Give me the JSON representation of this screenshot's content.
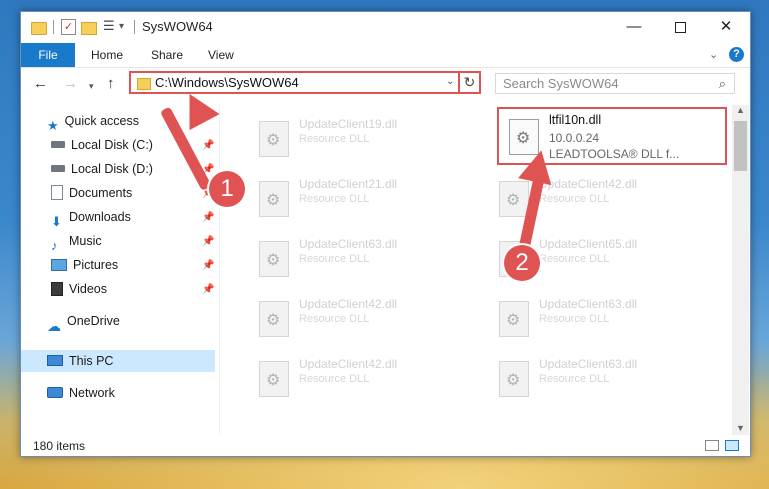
{
  "window": {
    "title": "SysWOW64",
    "controls": {
      "minimize": "—",
      "maximize": "",
      "close": "✕"
    }
  },
  "ribbon": {
    "tabs": [
      "File",
      "Home",
      "Share",
      "View"
    ],
    "help": "?",
    "expand": "⌄"
  },
  "navigation": {
    "back": "←",
    "forward": "→",
    "recent": "▾",
    "up": "↑",
    "address": "C:\\Windows\\SysWOW64",
    "address_dropdown": "⌄",
    "refresh": "↻",
    "search_placeholder": "Search SysWOW64",
    "search_icon": "⌕"
  },
  "sidebar": {
    "items": [
      {
        "label": "Quick access",
        "icon": "star-icon",
        "pinned": false
      },
      {
        "label": "Local Disk (C:)",
        "icon": "drive-icon",
        "pinned": true
      },
      {
        "label": "Local Disk (D:)",
        "icon": "drive-icon",
        "pinned": true
      },
      {
        "label": "Documents",
        "icon": "documents-icon",
        "pinned": true
      },
      {
        "label": "Downloads",
        "icon": "download-icon",
        "pinned": true
      },
      {
        "label": "Music",
        "icon": "music-icon",
        "pinned": true
      },
      {
        "label": "Pictures",
        "icon": "pictures-icon",
        "pinned": true
      },
      {
        "label": "Videos",
        "icon": "videos-icon",
        "pinned": true
      },
      {
        "label": "OneDrive",
        "icon": "cloud-icon",
        "pinned": false
      },
      {
        "label": "This PC",
        "icon": "computer-icon",
        "pinned": false,
        "selected": true
      },
      {
        "label": "Network",
        "icon": "network-icon",
        "pinned": false
      }
    ]
  },
  "files": {
    "highlighted": {
      "name": "ltfil10n.dll",
      "version": "10.0.0.24",
      "company": "LEADTOOLSA® DLL f..."
    },
    "tiles": [
      {
        "name": "UpdateClient19.dll",
        "type": "Resource DLL"
      },
      {
        "name": "UpdateClient21.dll",
        "type": "Resource DLL"
      },
      {
        "name": "UpdateClient42.dll",
        "type": "Resource DLL"
      },
      {
        "name": "UpdateClient63.dll",
        "type": "Resource DLL"
      },
      {
        "name": "UpdateClient65.dll",
        "type": "Resource DLL"
      },
      {
        "name": "UpdateClient42.dll",
        "type": "Resource DLL"
      },
      {
        "name": "UpdateClient63.dll",
        "type": "Resource DLL"
      },
      {
        "name": "UpdateClient42.dll",
        "type": "Resource DLL"
      },
      {
        "name": "UpdateClient63.dll",
        "type": "Resource DLL"
      }
    ]
  },
  "status": {
    "item_count": "180 items"
  },
  "annotations": {
    "step1": "1",
    "step2": "2",
    "color": "#e05353"
  }
}
